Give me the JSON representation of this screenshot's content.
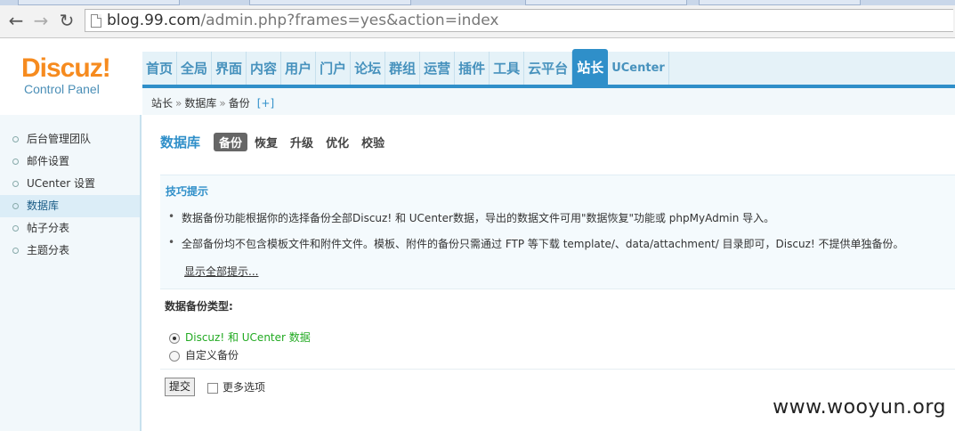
{
  "browser": {
    "url_host": "blog.99.com",
    "url_path": "/admin.php?frames=yes&action=index"
  },
  "logo": {
    "main": "Discuz!",
    "sub": "Control Panel"
  },
  "mainnav": [
    {
      "label": "首页"
    },
    {
      "label": "全局"
    },
    {
      "label": "界面"
    },
    {
      "label": "内容"
    },
    {
      "label": "用户"
    },
    {
      "label": "门户"
    },
    {
      "label": "论坛"
    },
    {
      "label": "群组"
    },
    {
      "label": "运营"
    },
    {
      "label": "插件"
    },
    {
      "label": "工具"
    },
    {
      "label": "云平台"
    },
    {
      "label": "站长",
      "active": true
    },
    {
      "label": "UCenter"
    }
  ],
  "breadcrumb": {
    "items": [
      "站长",
      "数据库",
      "备份"
    ],
    "separator": "»",
    "expand": "[+]"
  },
  "sidebar": {
    "items": [
      {
        "label": "后台管理团队"
      },
      {
        "label": "邮件设置"
      },
      {
        "label": "UCenter 设置"
      },
      {
        "label": "数据库",
        "active": true
      },
      {
        "label": "帖子分表"
      },
      {
        "label": "主题分表"
      }
    ]
  },
  "main": {
    "title": "数据库",
    "tabs": [
      {
        "label": "备份",
        "active": true
      },
      {
        "label": "恢复"
      },
      {
        "label": "升级"
      },
      {
        "label": "优化"
      },
      {
        "label": "校验"
      }
    ],
    "tips": {
      "title": "技巧提示",
      "items": [
        "数据备份功能根据你的选择备份全部Discuz! 和 UCenter数据，导出的数据文件可用\"数据恢复\"功能或 phpMyAdmin 导入。",
        "全部备份均不包含模板文件和附件文件。模板、附件的备份只需通过 FTP 等下载 template/、data/attachment/ 目录即可，Discuz! 不提供单独备份。"
      ],
      "show_all": "显示全部提示..."
    },
    "backup_type_label": "数据备份类型:",
    "options": [
      {
        "label": "Discuz! 和 UCenter 数据",
        "checked": true
      },
      {
        "label": "自定义备份",
        "checked": false
      }
    ],
    "submit_label": "提交",
    "more_options_label": "更多选项"
  },
  "watermark": "www.wooyun.org",
  "colors": {
    "accent": "#2f8fc9",
    "logo": "#f68b1f",
    "selected_option": "#22aa22"
  }
}
